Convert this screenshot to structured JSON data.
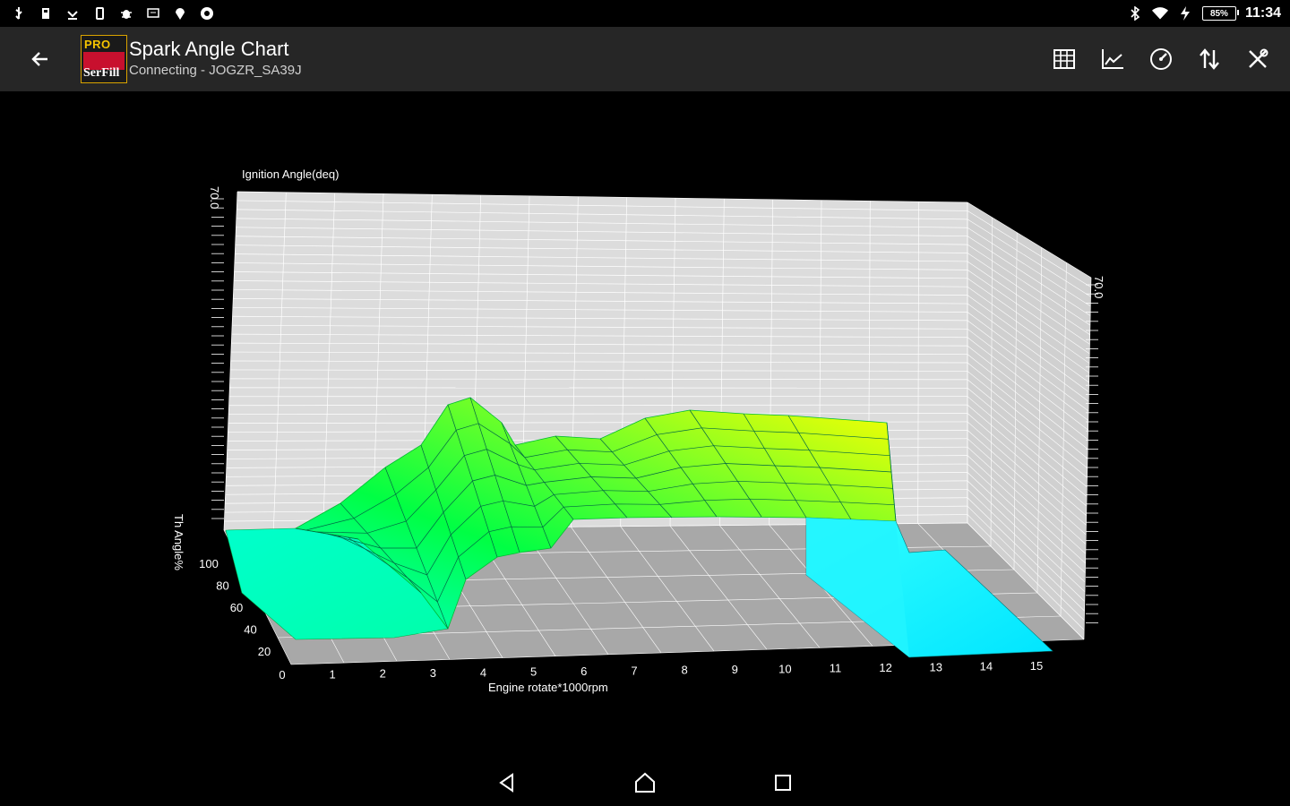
{
  "status_bar": {
    "time": "11:34",
    "battery_text": "85%",
    "left_icons": [
      "usb-icon",
      "sd-card-icon",
      "download-icon",
      "phone-icon",
      "bug-icon",
      "screen-icon",
      "location-icon",
      "record-icon"
    ],
    "right_icons": [
      "bluetooth-icon",
      "wifi-icon",
      "charging-icon"
    ]
  },
  "app_bar": {
    "title": "Spark Angle Chart",
    "subtitle": "Connecting - JOGZR_SA39J",
    "logo_top": "PRO",
    "logo_bottom": "SerFill",
    "actions": [
      "table-icon",
      "line-chart-icon",
      "gauge-icon",
      "sort-icon",
      "tools-icon"
    ]
  },
  "chart_data": {
    "type": "surface3d",
    "z_label": "Ignition Angle(deq)",
    "x_label": "Engine rotate*1000rpm",
    "y_label": "Th Angle%",
    "x_ticks": [
      "0",
      "1",
      "2",
      "3",
      "4",
      "5",
      "6",
      "7",
      "8",
      "9",
      "10",
      "11",
      "12",
      "13",
      "14",
      "15"
    ],
    "y_ticks": [
      "20",
      "40",
      "60",
      "80",
      "100"
    ],
    "z_top_label": "70.0",
    "colors": {
      "low": "#00ffff",
      "mid": "#00ff66",
      "high": "#ffff00",
      "wall": "#dcdcdc",
      "floor": "#a8a8a8"
    }
  }
}
